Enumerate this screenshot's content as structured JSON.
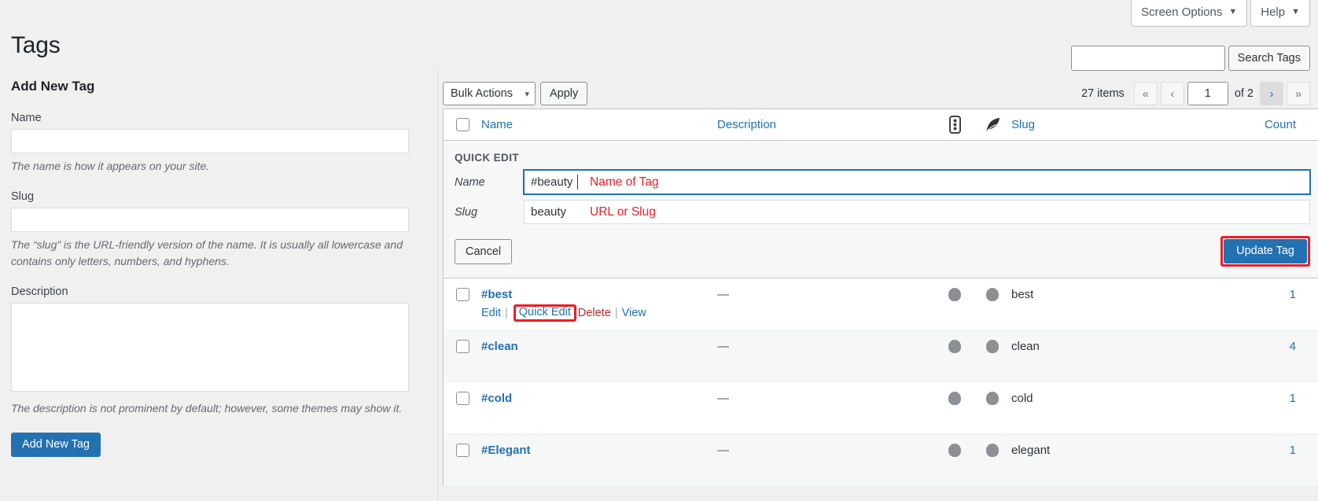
{
  "screen_meta": {
    "screen_options_label": "Screen Options",
    "help_label": "Help",
    "caret": "▼"
  },
  "page": {
    "title": "Tags"
  },
  "search": {
    "value": "",
    "placeholder": "",
    "button_label": "Search Tags"
  },
  "add_form": {
    "heading": "Add New Tag",
    "name_label": "Name",
    "name_value": "",
    "name_help": "The name is how it appears on your site.",
    "slug_label": "Slug",
    "slug_value": "",
    "slug_help": "The “slug” is the URL-friendly version of the name. It is usually all lowercase and contains only letters, numbers, and hyphens.",
    "description_label": "Description",
    "description_value": "",
    "description_help": "The description is not prominent by default; however, some themes may show it.",
    "submit_label": "Add New Tag"
  },
  "toolbar": {
    "bulk_actions_label": "Bulk Actions",
    "bulk_caret": "▾",
    "apply_label": "Apply"
  },
  "pagination": {
    "items_text": "27 items",
    "first_label": "«",
    "prev_label": "‹",
    "current_page": "1",
    "of_total": "of 2",
    "next_label": "›",
    "last_label": "»"
  },
  "table": {
    "columns": {
      "name": "Name",
      "description": "Description",
      "icon_1": "list-dots-icon",
      "icon_2": "feather-quill-icon",
      "slug": "Slug",
      "count": "Count"
    },
    "rows": [
      {
        "name": "#best",
        "description": "—",
        "slug": "best",
        "count": "1",
        "actions": {
          "edit": "Edit",
          "quick_edit": "Quick Edit",
          "delete": "Delete",
          "view": "View",
          "separator": "|"
        }
      },
      {
        "name": "#clean",
        "description": "—",
        "slug": "clean",
        "count": "4"
      },
      {
        "name": "#cold",
        "description": "—",
        "slug": "cold",
        "count": "1"
      },
      {
        "name": "#Elegant",
        "description": "—",
        "slug": "elegant",
        "count": "1"
      }
    ]
  },
  "quick_edit": {
    "legend": "QUICK EDIT",
    "name_label": "Name",
    "name_value": "#beauty",
    "name_annotation": "Name of Tag",
    "slug_label": "Slug",
    "slug_value": "beauty",
    "slug_annotation": "URL or Slug",
    "cancel_label": "Cancel",
    "update_label": "Update Tag"
  },
  "colors": {
    "accent_blue": "#2271b1",
    "link_blue": "#2271b1",
    "annotation_red": "#e8202a",
    "highlight_red": "#ee1c25",
    "page_bg": "#f0f0f1",
    "delete_red": "#b32d2e"
  }
}
